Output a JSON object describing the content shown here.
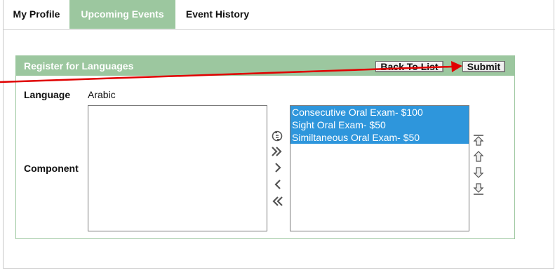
{
  "tabs": [
    {
      "label": "My Profile",
      "active": false
    },
    {
      "label": "Upcoming Events",
      "active": true
    },
    {
      "label": "Event History",
      "active": false
    }
  ],
  "panel": {
    "title": "Register for Languages",
    "back_label": "Back To List",
    "submit_label": "Submit"
  },
  "form": {
    "language_label": "Language",
    "language_value": "Arabic",
    "component_label": "Component"
  },
  "available_list": {
    "options": []
  },
  "selected_list": {
    "options": [
      "Consecutive Oral Exam- $100",
      "Sight Oral Exam- $50",
      "Similtaneous Oral Exam- $50"
    ]
  },
  "colors": {
    "header_green": "#9cc79f",
    "selection_blue": "#2e96dc",
    "annotation_red": "#e00000"
  },
  "icons": {
    "transfer": [
      "swap-icon",
      "move-all-right-icon",
      "move-right-icon",
      "move-left-icon",
      "move-all-left-icon"
    ],
    "order": [
      "move-top-icon",
      "move-up-icon",
      "move-down-icon",
      "move-bottom-icon"
    ]
  }
}
